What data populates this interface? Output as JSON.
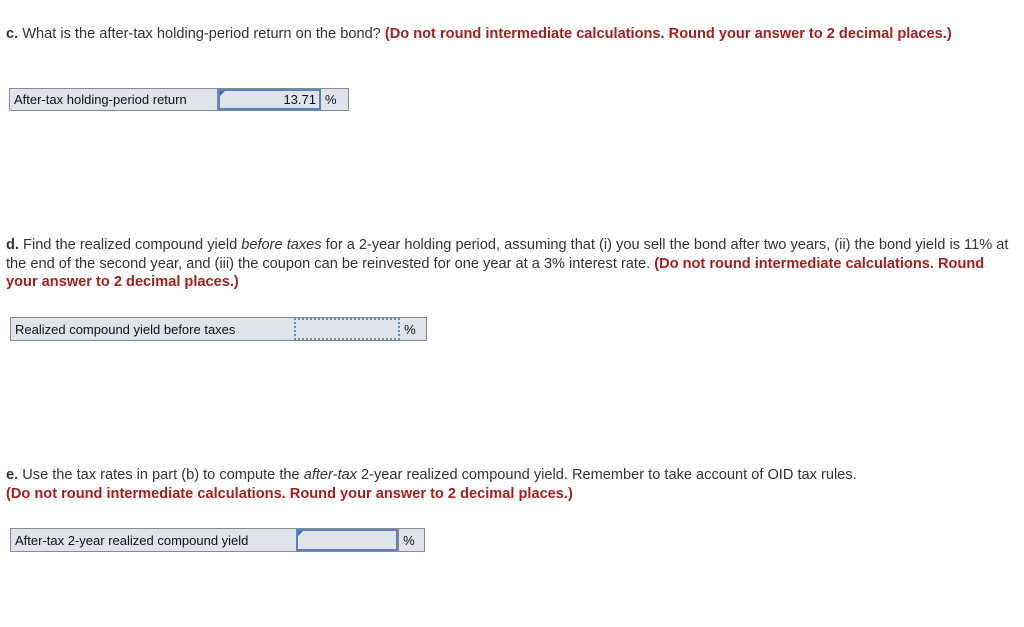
{
  "parts": [
    {
      "id": "c",
      "lead": "c.",
      "segments": [
        {
          "text": " What is the after-tax holding-period return on the bond? ",
          "style": "normal"
        },
        {
          "text": "(Do not round intermediate calculations. Round your answer to 2 decimal places.)",
          "style": "red"
        }
      ],
      "answer_row": {
        "label": "After-tax holding-period return",
        "value": "13.71",
        "unit": "%"
      }
    },
    {
      "id": "d",
      "lead": "d.",
      "segments": [
        {
          "text": " Find the realized compound yield ",
          "style": "normal"
        },
        {
          "text": "before taxes",
          "style": "italic"
        },
        {
          "text": " for a 2-year holding period, assuming that (i) you sell the bond after two years, (ii) the bond yield is 11% at the end of the second year, and (iii) the coupon can be reinvested for one year at a 3% interest rate. ",
          "style": "normal"
        },
        {
          "text": "(Do not round intermediate calculations. Round your answer to 2 decimal places.)",
          "style": "red"
        }
      ],
      "answer_row": {
        "label": "Realized compound yield before taxes",
        "value": "",
        "unit": "%"
      }
    },
    {
      "id": "e",
      "lead": "e.",
      "segments": [
        {
          "text": " Use the tax rates in part (b) to compute the ",
          "style": "normal"
        },
        {
          "text": "after-tax",
          "style": "italic"
        },
        {
          "text": " 2-year realized compound yield. Remember to take account of OID tax rules.",
          "style": "normal"
        },
        {
          "text": "(Do not round intermediate calculations. Round your answer to 2 decimal places.)",
          "style": "red",
          "newline": true
        }
      ],
      "answer_row": {
        "label": "After-tax 2-year realized compound yield",
        "value": "",
        "unit": "%"
      }
    }
  ],
  "colors": {
    "instruction_red": "#a5201c",
    "input_border_blue": "#5a83bf",
    "cell_background": "#dfe3ec"
  }
}
